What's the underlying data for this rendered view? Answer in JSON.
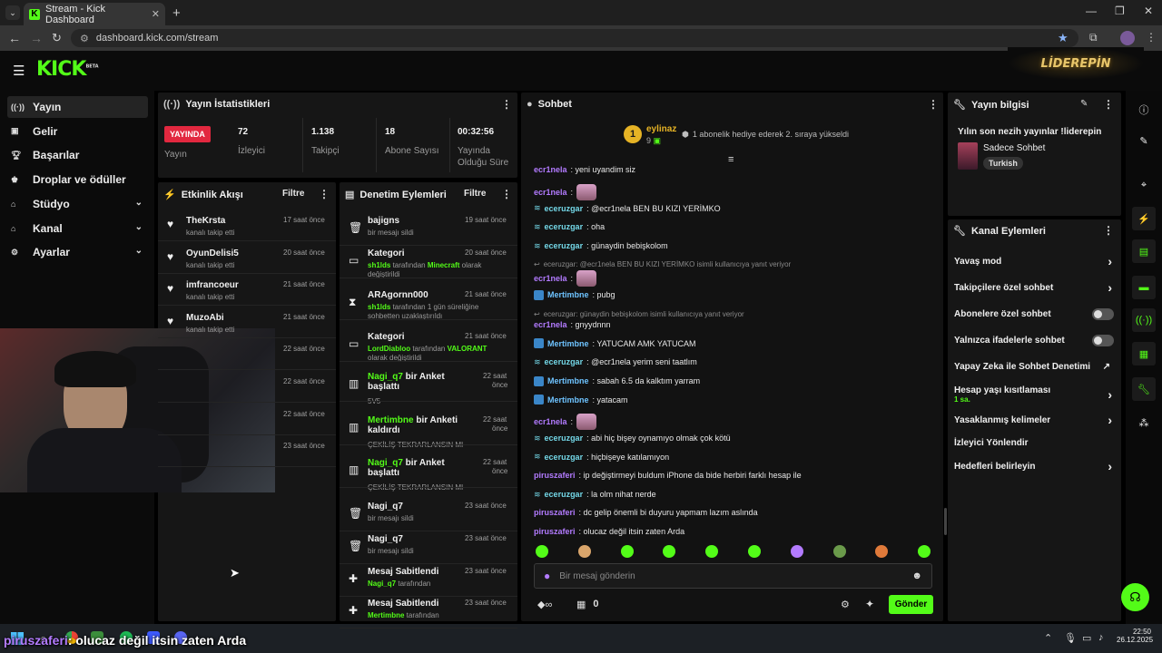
{
  "browser": {
    "tab_title": "Stream - Kick Dashboard",
    "url": "dashboard.kick.com/stream"
  },
  "header": {
    "logo_text": "KICK",
    "logo_beta": "BETA",
    "banner_text": "LİDEREPİN"
  },
  "sidebar": {
    "items": [
      {
        "label": "Yayın",
        "icon": "broadcast-icon"
      },
      {
        "label": "Gelir",
        "icon": "money-icon"
      },
      {
        "label": "Başarılar",
        "icon": "trophy-icon"
      },
      {
        "label": "Droplar ve ödüller",
        "icon": "gift-icon"
      },
      {
        "label": "Stüdyo",
        "icon": "studio-icon"
      },
      {
        "label": "Kanal",
        "icon": "channel-icon"
      },
      {
        "label": "Ayarlar",
        "icon": "gear-icon"
      }
    ]
  },
  "stats": {
    "title": "Yayın İstatistikleri",
    "live_label": "YAYINDA",
    "status_label": "Yayın",
    "viewers": "72",
    "viewers_label": "İzleyici",
    "followers": "1.138",
    "followers_label": "Takipçi",
    "subs": "18",
    "subs_label": "Abone Sayısı",
    "uptime": "00:32:56",
    "uptime_label1": "Yayında",
    "uptime_label2": "Olduğu Süre"
  },
  "activity": {
    "title": "Etkinlik Akışı",
    "filter": "Filtre",
    "events": [
      {
        "name": "TheKrsta",
        "sub": "kanalı takip etti",
        "time": "17 saat önce"
      },
      {
        "name": "OyunDelisi5",
        "sub": "kanalı takip etti",
        "time": "20 saat önce"
      },
      {
        "name": "imfrancoeur",
        "sub": "kanalı takip etti",
        "time": "21 saat önce"
      },
      {
        "name": "MuzoAbi",
        "sub": "kanalı takip etti",
        "time": "21 saat önce"
      },
      {
        "name": "",
        "sub": "",
        "time": "22 saat önce"
      },
      {
        "name": "",
        "sub": "",
        "time": "22 saat önce"
      },
      {
        "name": "",
        "sub": "",
        "time": "22 saat önce"
      },
      {
        "name": "",
        "sub": "",
        "time": "23 saat önce"
      }
    ]
  },
  "moderation": {
    "title": "Denetim Eylemleri",
    "filter": "Filtre",
    "items": [
      {
        "title": "bajigns",
        "l1": "bir mesajı sildi",
        "time": "19 saat önce"
      },
      {
        "title": "Kategori",
        "l1a": "sh1lds",
        "l1b": " tarafından ",
        "l1c": "Minecraft",
        "l1d": " olarak",
        "l2": "değiştirildi",
        "time": "20 saat önce"
      },
      {
        "title": "ARAgornn000",
        "l1a": "sh1lds",
        "l1b": " tarafından 1 gün süreliğine",
        "l2": "sohbetten uzaklaştırıldı",
        "time": "21 saat önce"
      },
      {
        "title": "Kategori",
        "l1a": "LordDiabloo",
        "l1b": " tarafından ",
        "l1c": "VALORANT",
        "l2": "olarak değiştirildi",
        "time": "21 saat önce"
      },
      {
        "title_a": "Nagi_q7",
        "title_b": " bir Anket",
        "title_c": "başlattı",
        "l1": "5V5",
        "time1": "22 saat",
        "time2": "önce"
      },
      {
        "title_a": "Mertimbne",
        "title_b": " bir Anketi",
        "title_c": "kaldırdı",
        "l1": "ÇEKİLİŞ TEKRARLANSIN MI",
        "time1": "22 saat",
        "time2": "önce"
      },
      {
        "title_a": "Nagi_q7",
        "title_b": " bir Anket",
        "title_c": "başlattı",
        "l1": "ÇEKİLİŞ TEKRARLANSIN MI",
        "time1": "22 saat",
        "time2": "önce"
      },
      {
        "title": "Nagi_q7",
        "l1": "bir mesajı sildi",
        "time": "23 saat önce"
      },
      {
        "title": "Nagi_q7",
        "l1": "bir mesajı sildi",
        "time": "23 saat önce"
      },
      {
        "title": "Mesaj Sabitlendi",
        "l1a": "Nagi_q7",
        "l1b": " tarafından",
        "time": "23 saat önce"
      },
      {
        "title": "Mesaj Sabitlendi",
        "l1a": "Mertimbne",
        "l1b": " tarafından",
        "time": "23 saat önce"
      }
    ]
  },
  "chat": {
    "title": "Sohbet",
    "gift_user": "eylinaz",
    "gift_rank": "1",
    "gift_count": "9",
    "gift_text": "1 abonelik hediye ederek 2. sıraya yükseldi",
    "messages": [
      {
        "user": "ecr1nela",
        "text": ": yeni uyandim siz",
        "color": "purple"
      },
      {
        "user": "ecr1nela",
        "text": ":",
        "color": "purple",
        "emote": true
      },
      {
        "user": "eceruzgar",
        "text": ": @ecr1nela BEN BU KIZI YERİMKO",
        "color": "cyan"
      },
      {
        "user": "eceruzgar",
        "text": ": oha",
        "color": "cyan"
      },
      {
        "user": "eceruzgar",
        "text": ": günaydin bebişkolom",
        "color": "cyan"
      },
      {
        "reply": "eceruzgar: @ecr1nela BEN BU KIZI YERİMKO isimli kullanıcıya yanıt veriyor",
        "user": "ecr1nela",
        "text": ":",
        "color": "purple",
        "emote": true
      },
      {
        "user": "Mertimbne",
        "text": ": pubg",
        "color": "blue"
      },
      {
        "reply": "eceruzgar: günaydin bebişkolom isimli kullanıcıya yanıt veriyor",
        "user": "ecr1nela",
        "text": ": gnyydnnn",
        "color": "purple"
      },
      {
        "user": "Mertimbne",
        "text": ": YATUCAM AMK YATUCAM",
        "color": "blue"
      },
      {
        "user": "eceruzgar",
        "text": ": @ecr1nela yerim seni taatlım",
        "color": "cyan"
      },
      {
        "user": "Mertimbne",
        "text": ": sabah 6.5 da kalktım yarram",
        "color": "blue"
      },
      {
        "user": "Mertimbne",
        "text": ": yatacam",
        "color": "blue"
      },
      {
        "user": "ecr1nela",
        "text": ":",
        "color": "purple",
        "emote": true
      },
      {
        "user": "eceruzgar",
        "text": ": abi hiç bişey oynamıyo olmak çok kötü",
        "color": "cyan"
      },
      {
        "user": "eceruzgar",
        "text": ": hiçbişeye katılamıyon",
        "color": "cyan"
      },
      {
        "user": "piruszaferi",
        "text": ": ip değiştirmeyi buldum iPhone da bide herbiri farklı hesap ile",
        "color": "purple"
      },
      {
        "user": "eceruzgar",
        "text": ": la olm nihat nerde",
        "color": "cyan"
      },
      {
        "user": "piruszaferi",
        "text": ": dc gelip önemli bi duyuru yapmam lazım aslında",
        "color": "purple"
      },
      {
        "user": "piruszaferi",
        "text": ": olucaz değil itsin zaten Arda",
        "color": "purple"
      }
    ],
    "input_placeholder": "Bir mesaj gönderin",
    "points": "0",
    "send": "Gönder"
  },
  "stream_info": {
    "title": "Yayın bilgisi",
    "stream_title": "Yılın son nezih yayınlar !liderepin",
    "category": "Sadece Sohbet",
    "tag": "Turkish"
  },
  "channel_actions": {
    "title": "Kanal Eylemleri",
    "items": [
      {
        "label": "Yavaş mod",
        "type": "chevron"
      },
      {
        "label": "Takipçilere özel sohbet",
        "type": "chevron"
      },
      {
        "label": "Abonelere özel sohbet",
        "type": "toggle"
      },
      {
        "label": "Yalnızca ifadelerle sohbet",
        "type": "toggle"
      },
      {
        "label": "Yapay Zeka ile Sohbet Denetimi",
        "type": "external"
      },
      {
        "label": "Hesap yaşı kısıtlaması",
        "sub": "1 sa.",
        "type": "chevron"
      },
      {
        "label": "Yasaklanmış kelimeler",
        "type": "chevron"
      },
      {
        "label": "İzleyici Yönlendir",
        "type": "none"
      },
      {
        "label": "Hedefleri belirleyin",
        "type": "chevron"
      }
    ]
  },
  "taskbar": {
    "overlay_user": "piruszaferi",
    "overlay_text": ": olucaz değil itsin zaten Arda",
    "time": "22:50",
    "date": "26.12.2025"
  }
}
